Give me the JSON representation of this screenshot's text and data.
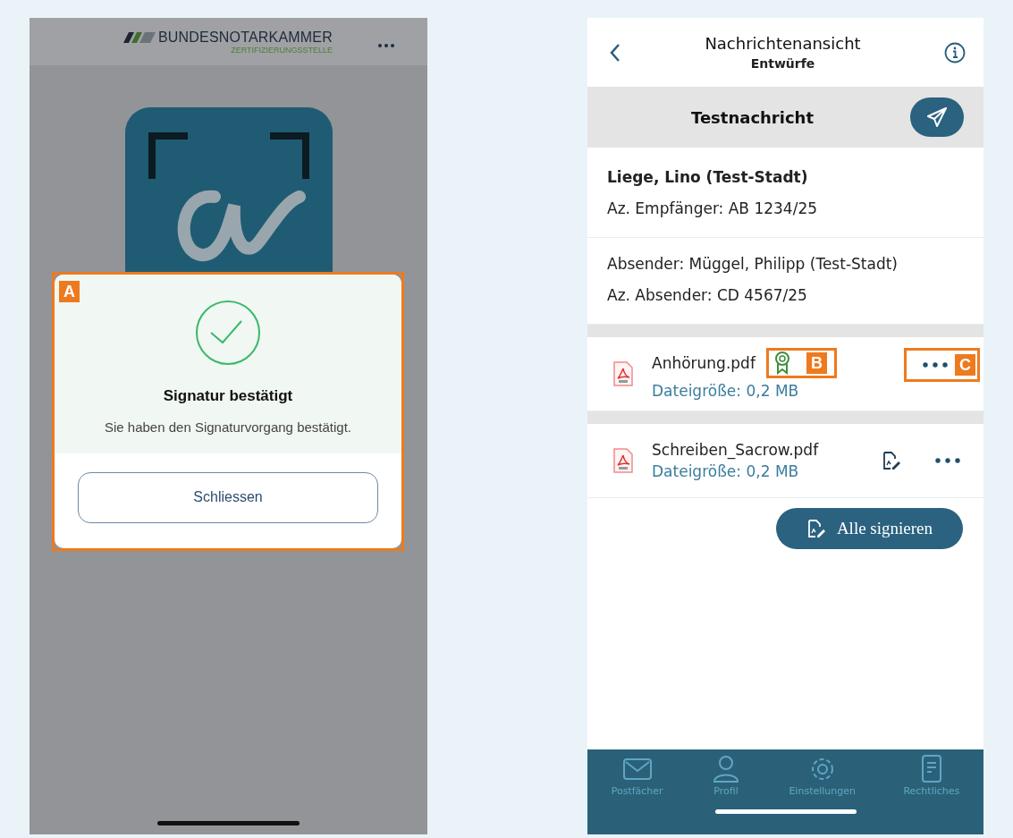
{
  "left_phone": {
    "logo": {
      "title": "BUNDESNOTARKAMMER",
      "subtitle": "ZERTIFIZIERUNGSSTELLE"
    },
    "dialog": {
      "callout": "A",
      "title": "Signatur bestätigt",
      "message": "Sie haben den Signaturvorgang bestätigt.",
      "button": "Schliessen"
    }
  },
  "right_phone": {
    "title": "Nachrichtenansicht",
    "subtitle": "Entwürfe",
    "subject": "Testnachricht",
    "recipient": {
      "name": "Liege, Lino (Test-Stadt)",
      "reference": "Az. Empfänger: AB 1234/25"
    },
    "sender": {
      "name": "Absender: Müggel, Philipp (Test-Stadt)",
      "reference": "Az. Absender: CD 4567/25"
    },
    "attachments": [
      {
        "name": "Anhörung.pdf",
        "size": "Dateigröße: 0,2 MB",
        "kind": "signed",
        "status_callout": "B",
        "more_callout": "C"
      },
      {
        "name": "Schreiben_Sacrow.pdf",
        "size": "Dateigröße: 0,2 MB",
        "kind": "signable"
      }
    ],
    "sign_all_button": "Alle signieren",
    "tabs": [
      {
        "label": "Postfächer",
        "kind": "mail"
      },
      {
        "label": "Profil",
        "kind": "profile"
      },
      {
        "label": "Einstellungen",
        "kind": "settings"
      },
      {
        "label": "Rechtliches",
        "kind": "document"
      }
    ]
  }
}
